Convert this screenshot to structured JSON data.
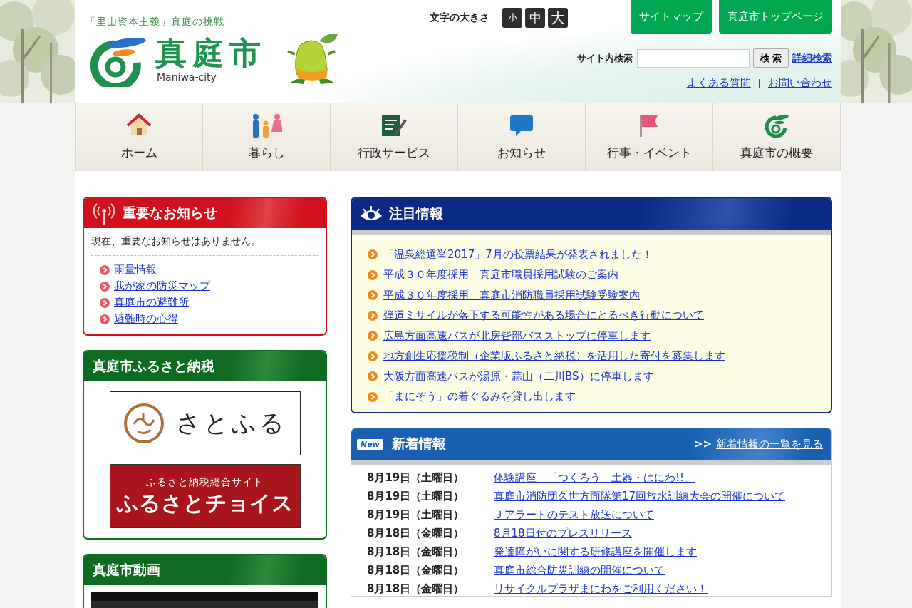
{
  "header": {
    "tagline": "「里山資本主義」真庭の挑戦",
    "city_name": "真庭市",
    "city_name_romaji": "Maniwa-city",
    "font_size": {
      "label": "文字の大きさ",
      "options": [
        "小",
        "中",
        "大"
      ]
    },
    "top_buttons": [
      "サイトマップ",
      "真庭市トップページ"
    ],
    "search": {
      "label": "サイト内検索",
      "button": "検 索",
      "advanced_link": "詳細検索"
    },
    "links": [
      "よくある質問",
      "お問い合わせ"
    ],
    "link_separator": "|"
  },
  "nav": [
    {
      "label": "ホーム"
    },
    {
      "label": "暮らし"
    },
    {
      "label": "行政サービス"
    },
    {
      "label": "お知らせ"
    },
    {
      "label": "行事・イベント"
    },
    {
      "label": "真庭市の概要"
    }
  ],
  "notice": {
    "title": "重要なお知らせ",
    "message": "現在、重要なお知らせはありません。",
    "links": [
      "雨量情報",
      "我が家の防災マップ",
      "真庭市の避難所",
      "避難時の心得"
    ]
  },
  "furusato": {
    "title": "真庭市ふるさと納税",
    "banners": [
      {
        "kind": "satofuru",
        "text": "さとふる"
      },
      {
        "kind": "choice",
        "subtitle": "ふるさと納税総合サイト",
        "text": "ふるさとチョイス"
      }
    ]
  },
  "video": {
    "title": "真庭市動画"
  },
  "featured": {
    "title": "注目情報",
    "items": [
      "「温泉総選挙2017」7月の投票結果が発表されました！",
      "平成３０年度採用　真庭市職員採用試験のご案内",
      "平成３０年度採用　真庭市消防職員採用試験受験案内",
      "弾道ミサイルが落下する可能性がある場合にとるべき行動について",
      "広島方面高速バスが北房呰部バスストップに停車します",
      "地方創生応援税制（企業版ふるさと納税）を活用した寄付を募集します",
      "大阪方面高速バスが湯原・蒜山（二川BS）に停車します",
      "「まにぞう」の着ぐるみを貸し出します"
    ]
  },
  "news": {
    "badge": "New",
    "title": "新着情報",
    "more_prefix": ">>",
    "more_link": "新着情報の一覧を見る",
    "rows": [
      {
        "date": "8月19日（土曜日）",
        "title": "体験講座　「つくろう　土器・はにわ!!」"
      },
      {
        "date": "8月19日（土曜日）",
        "title": "真庭市消防団久世方面隊第17回放水訓練大会の開催について"
      },
      {
        "date": "8月19日（土曜日）",
        "title": "Ｊアラートのテスト放送について"
      },
      {
        "date": "8月18日（金曜日）",
        "title": "8月18日付のプレスリリース"
      },
      {
        "date": "8月18日（金曜日）",
        "title": "発達障がいに関する研修講座を開催します"
      },
      {
        "date": "8月18日（金曜日）",
        "title": "真庭市総合防災訓練の開催について"
      },
      {
        "date": "8月18日（金曜日）",
        "title": "リサイクルプラザまにわをご利用ください！"
      }
    ]
  }
}
